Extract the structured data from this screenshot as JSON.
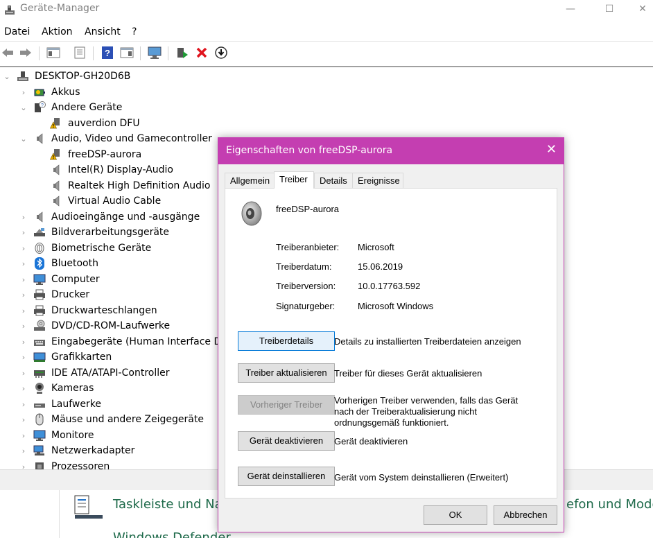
{
  "window": {
    "title": "Geräte-Manager",
    "minimize": "—",
    "maximize": "☐",
    "close": "✕"
  },
  "menu": [
    "Datei",
    "Aktion",
    "Ansicht",
    "?"
  ],
  "toolbar_icons": [
    "back-arrow-icon",
    "forward-arrow-icon",
    "show-hide-console-tree-icon",
    "properties-icon",
    "help-icon",
    "action-pane-icon",
    "scan-hardware-icon",
    "update-driver-icon",
    "uninstall-device-icon",
    "disable-device-icon"
  ],
  "tree": {
    "root": "DESKTOP-GH20D6B",
    "items": [
      {
        "label": "Akkus",
        "icon": "battery-icon"
      },
      {
        "label": "Andere Geräte",
        "icon": "unknown-device-icon",
        "expanded": true,
        "children": [
          {
            "label": "auverdion DFU",
            "icon": "warning-device-icon"
          }
        ]
      },
      {
        "label": "Audio, Video und Gamecontroller",
        "icon": "speaker-icon",
        "expanded": true,
        "children": [
          {
            "label": "freeDSP-aurora",
            "icon": "warning-device-icon"
          },
          {
            "label": "Intel(R) Display-Audio",
            "icon": "speaker-icon"
          },
          {
            "label": "Realtek High Definition Audio",
            "icon": "speaker-icon"
          },
          {
            "label": "Virtual Audio Cable",
            "icon": "speaker-icon"
          }
        ]
      },
      {
        "label": "Audioeingänge und -ausgänge",
        "icon": "speaker-icon"
      },
      {
        "label": "Bildverarbeitungsgeräte",
        "icon": "camera-icon"
      },
      {
        "label": "Biometrische Geräte",
        "icon": "fingerprint-icon"
      },
      {
        "label": "Bluetooth",
        "icon": "bluetooth-icon"
      },
      {
        "label": "Computer",
        "icon": "monitor-icon"
      },
      {
        "label": "Drucker",
        "icon": "printer-icon"
      },
      {
        "label": "Druckwarteschlangen",
        "icon": "printer-icon"
      },
      {
        "label": "DVD/CD-ROM-Laufwerke",
        "icon": "disc-drive-icon"
      },
      {
        "label": "Eingabegeräte (Human Interface Devi",
        "icon": "keyboard-icon"
      },
      {
        "label": "Grafikkarten",
        "icon": "display-adapter-icon"
      },
      {
        "label": "IDE ATA/ATAPI-Controller",
        "icon": "controller-icon"
      },
      {
        "label": "Kameras",
        "icon": "webcam-icon"
      },
      {
        "label": "Laufwerke",
        "icon": "drive-icon"
      },
      {
        "label": "Mäuse und andere Zeigegeräte",
        "icon": "mouse-icon"
      },
      {
        "label": "Monitore",
        "icon": "monitor-icon"
      },
      {
        "label": "Netzwerkadapter",
        "icon": "network-icon"
      },
      {
        "label": "Prozessoren",
        "icon": "processor-icon"
      }
    ]
  },
  "background": {
    "left_text": "Taskleiste und Na",
    "right_text": "efon und Mode",
    "bottom_text": "Windows Defender"
  },
  "dialog": {
    "title": "Eigenschaften von freeDSP-aurora",
    "close": "✕",
    "tabs": [
      "Allgemein",
      "Treiber",
      "Details",
      "Ereignisse"
    ],
    "active_tab": "Treiber",
    "device_name": "freeDSP-aurora",
    "properties": [
      {
        "label": "Treiberanbieter:",
        "value": "Microsoft"
      },
      {
        "label": "Treiberdatum:",
        "value": "15.06.2019"
      },
      {
        "label": "Treiberversion:",
        "value": "10.0.17763.592"
      },
      {
        "label": "Signaturgeber:",
        "value": "Microsoft Windows"
      }
    ],
    "actions": [
      {
        "button": "Treiberdetails",
        "description": "Details zu installierten Treiberdateien anzeigen"
      },
      {
        "button": "Treiber aktualisieren",
        "description": "Treiber für dieses Gerät aktualisieren"
      },
      {
        "button": "Vorheriger Treiber",
        "description": "Vorherigen Treiber verwenden, falls das Gerät nach der Treiberaktualisierung nicht ordnungsgemäß funktioniert.",
        "disabled": true
      },
      {
        "button": "Gerät deaktivieren",
        "description": "Gerät deaktivieren"
      },
      {
        "button": "Gerät deinstallieren",
        "description": "Gerät vom System deinstallieren (Erweitert)"
      }
    ],
    "ok": "OK",
    "cancel": "Abbrechen"
  },
  "colors": {
    "dialog_accent": "#c43eb1",
    "focus_blue": "#0078d7"
  }
}
